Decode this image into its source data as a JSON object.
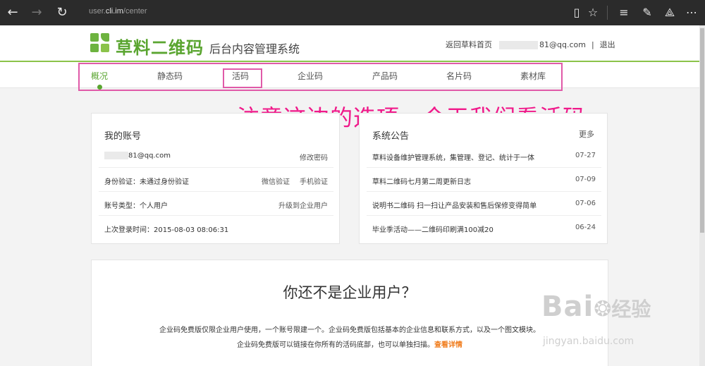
{
  "browser": {
    "url_prefix": "user.",
    "url_domain": "cli.im",
    "url_path": "/center"
  },
  "header": {
    "brand": "草料二维码",
    "subtitle": "后台内容管理系统",
    "home_link": "返回草料首页",
    "email": "81@qq.com",
    "separator": "|",
    "logout": "退出"
  },
  "tabs": [
    "概况",
    "静态码",
    "活码",
    "企业码",
    "产品码",
    "名片码",
    "素材库"
  ],
  "annotation": "注意这边的选项，今天我们看活码",
  "account": {
    "title": "我的账号",
    "email": "81@qq.com",
    "change_password": "修改密码",
    "verify_label": "身份验证：未通过身份验证",
    "wechat_verify": "微信验证",
    "phone_verify": "手机验证",
    "type_label": "账号类型：个人用户",
    "upgrade": "升级到企业用户",
    "last_login": "上次登录时间：2015-08-03 08:06:31"
  },
  "notices": {
    "title": "系统公告",
    "more": "更多",
    "items": [
      {
        "text": "草料设备维护管理系统，集管理、登记、统计于一体",
        "date": "07-27"
      },
      {
        "text": "草料二维码七月第二周更新日志",
        "date": "07-09"
      },
      {
        "text": "说明书二维码 扫一扫让产品安装和售后保修变得简单",
        "date": "07-06"
      },
      {
        "text": "毕业季活动——二维码印刷满100减20",
        "date": "06-24"
      }
    ]
  },
  "enterprise": {
    "title": "你还不是企业用户？",
    "para1": "企业码免费版仅限企业用户使用，一个账号限建一个。企业码免费版包括基本的企业信息和联系方式，以及一个图文模块。",
    "para2": "企业码免费版可以链接在你所有的活码底部，也可以单独扫描。",
    "details_link": "查看详情"
  },
  "watermark": {
    "brand": "Bai",
    "brand2": "经验",
    "site": "jingyan.baidu.com"
  },
  "colors": {
    "brand_green": "#5aa530",
    "highlight_pink": "#e05aa8",
    "annotation_magenta": "#f0198a",
    "link_orange": "#f07c1c"
  }
}
